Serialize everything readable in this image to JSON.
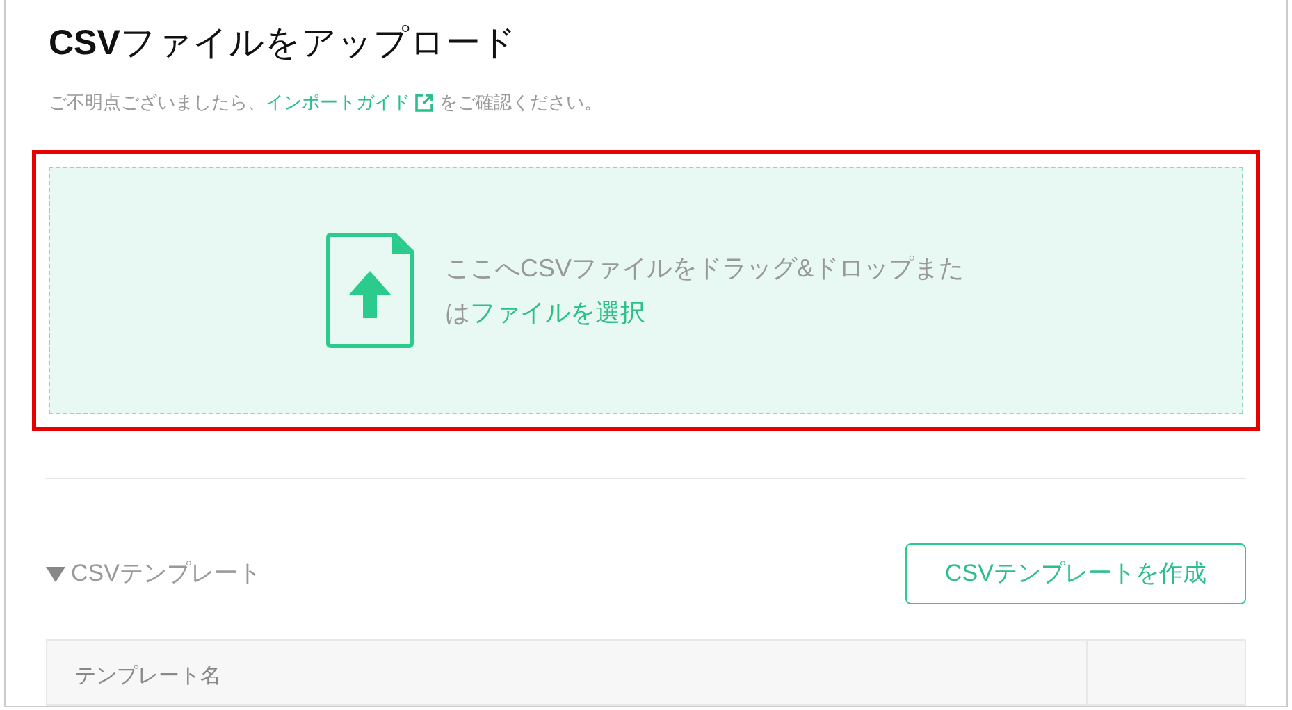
{
  "title": "**CSV**ファイルをアップロード",
  "help": {
    "before": "ご不明点ございましたら、",
    "link": "インポートガイド",
    "after": "をご確認ください。"
  },
  "dropzone": {
    "highlighted": true,
    "text": "ここへCSVファイルをドラッグ&ドロップまたは",
    "link": "ファイルを選択"
  },
  "template_section": {
    "title": "CSVテンプレート",
    "expanded": true,
    "button": "CSVテンプレートを作成"
  },
  "table": {
    "columns": [
      "テンプレート名"
    ]
  }
}
